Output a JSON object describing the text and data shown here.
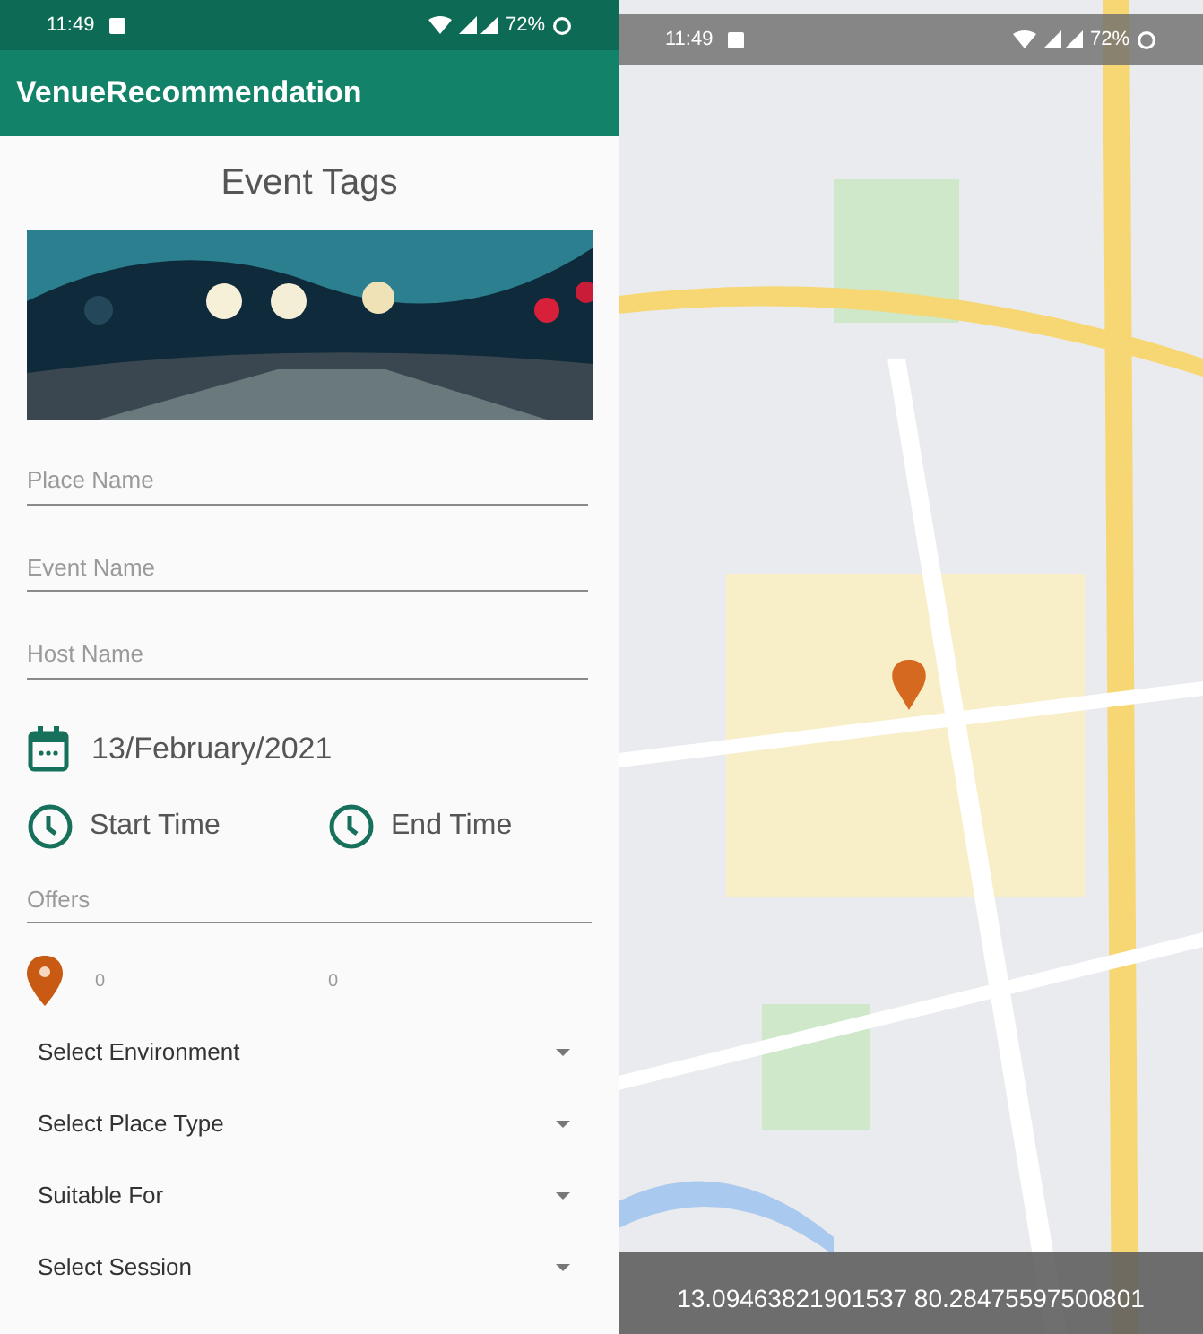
{
  "left_screen": {
    "status_bar": {
      "time": "11:49",
      "battery": "72%"
    },
    "app_bar": {
      "title": "VenueRecommendation"
    },
    "heading": "Event Tags",
    "fields": [
      {
        "placeholder": "Place Name"
      },
      {
        "placeholder": "Event Name"
      },
      {
        "placeholder": "Host Name"
      }
    ],
    "date": "13/February/2021",
    "start_time": "Start Time",
    "end_time": "End Time",
    "offers": {
      "placeholder": "Offers"
    },
    "location": {
      "latitude": "0",
      "longitude": "0"
    },
    "dropdowns": [
      {
        "label": "Select Environment"
      },
      {
        "label": "Select Place Type"
      },
      {
        "label": "Suitable For"
      },
      {
        "label": "Select Session"
      }
    ]
  },
  "right_screen": {
    "status_bar": {
      "time": "11:49",
      "battery": "72%"
    },
    "coordinates": "13.09463821901537 80.28475597500801"
  }
}
